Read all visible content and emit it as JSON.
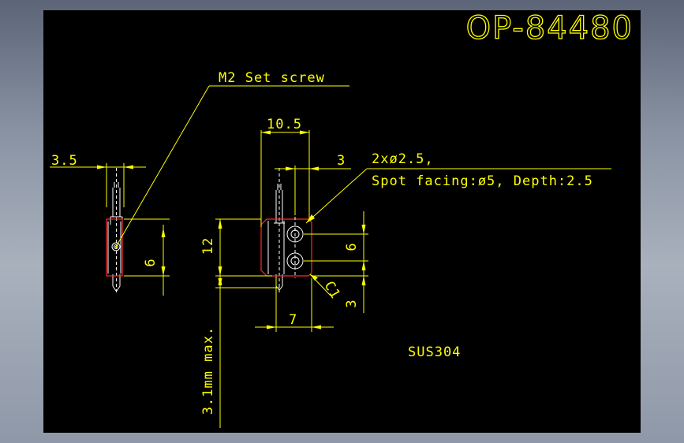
{
  "title": "OP-84480",
  "material": "SUS304",
  "callouts": {
    "set_screw": "M2 Set screw",
    "hole_spec_line1": "2xø2.5,",
    "hole_spec_line2": "Spot facing:ø5, Depth:2.5",
    "clearance": "3.1mm max."
  },
  "dimensions": {
    "pin_width": "3.5",
    "block_width": "10.5",
    "hole_offset_top": "3",
    "block_height": "12",
    "left_height": "6",
    "hole_pitch": "6",
    "hole_offset_bottom": "3",
    "bottom_width": "7",
    "chamfer": "C1"
  },
  "colors": {
    "background": "#000000",
    "dimension": "#ffff00",
    "outline": "#ffffff",
    "highlight": "#ff2a2a"
  }
}
